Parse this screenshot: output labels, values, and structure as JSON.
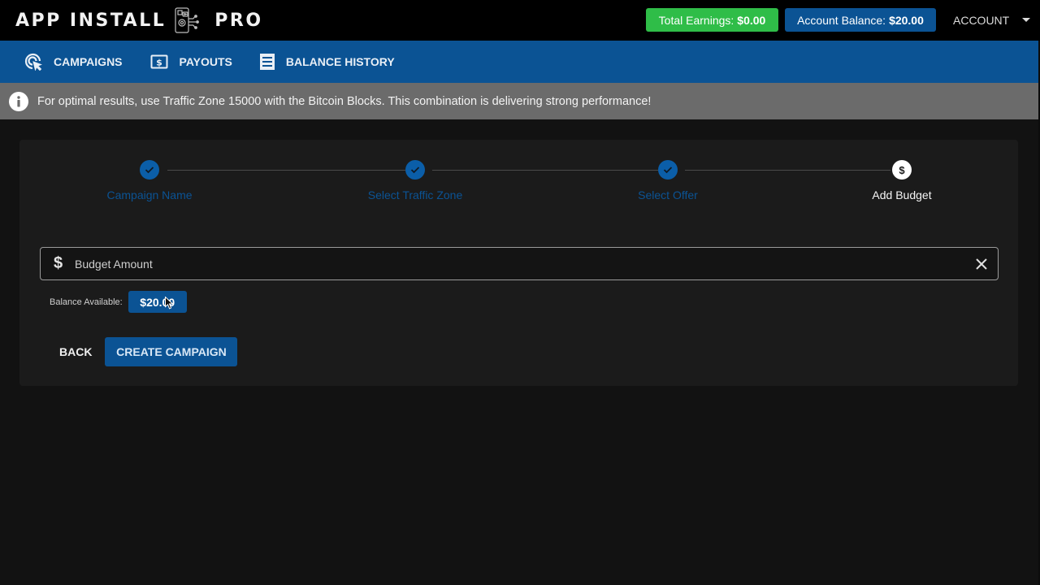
{
  "header": {
    "logo_left": "APP INSTALL",
    "logo_right": "PRO",
    "logo_icon": "phone-gear-network-icon",
    "total_earnings_label": "Total Earnings:",
    "total_earnings_value": "$0.00",
    "account_balance_label": "Account Balance:",
    "account_balance_value": "$20.00",
    "account_menu_label": "ACCOUNT"
  },
  "nav": {
    "items": [
      {
        "label": "CAMPAIGNS",
        "icon": "cursor-click-icon"
      },
      {
        "label": "PAYOUTS",
        "icon": "dollar-bill-icon"
      },
      {
        "label": "BALANCE HISTORY",
        "icon": "receipt-icon"
      }
    ]
  },
  "alert": {
    "icon": "info-icon",
    "message": "For optimal results, use Traffic Zone 15000 with the Bitcoin Blocks. This combination is delivering strong performance!"
  },
  "stepper": {
    "steps": [
      {
        "label": "Campaign Name",
        "status": "completed"
      },
      {
        "label": "Select Traffic Zone",
        "status": "completed"
      },
      {
        "label": "Select Offer",
        "status": "completed"
      },
      {
        "label": "Add Budget",
        "status": "active"
      }
    ]
  },
  "budget_form": {
    "placeholder": "Budget Amount",
    "value": "",
    "prefix_symbol": "$",
    "balance_label": "Balance Available:",
    "balance_value": "$20.00"
  },
  "actions": {
    "back_label": "BACK",
    "create_label": "CREATE CAMPAIGN"
  },
  "colors": {
    "brand_blue": "#0b5394",
    "earnings_green": "#2fbd48",
    "alert_gray": "#6b6b6b",
    "background": "#121212",
    "card": "#1b1b1b"
  }
}
